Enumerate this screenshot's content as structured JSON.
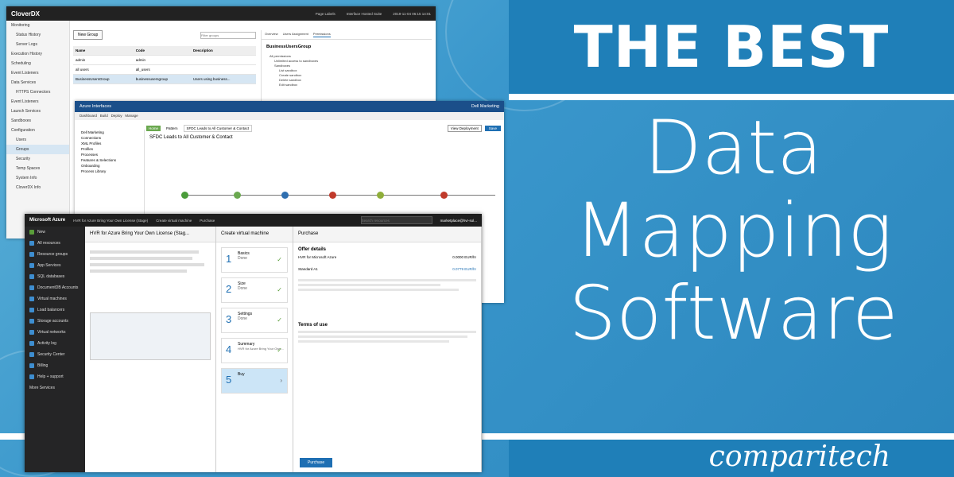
{
  "banner": {
    "title_top": "THE BEST",
    "title_line1": "Data",
    "title_line2": "Mapping",
    "title_line3": "Software",
    "logo": "comparitech"
  },
  "cloverdx": {
    "app_title": "CloverDX",
    "header_items": [
      "Page Labels",
      "Interface Hosted Suite",
      "2019-11-04 06:15 14:01"
    ],
    "sidebar": [
      "Monitoring",
      "Status History",
      "Server Logs",
      "Execution History",
      "Scheduling",
      "Event Listeners",
      "Data Services",
      "HTTPS Connectors",
      "Event Listeners",
      "Launch Services",
      "Sandboxes",
      "Configuration",
      "Users",
      "Groups",
      "Security",
      "Temp Spaces",
      "System Info",
      "CloverDX Info"
    ],
    "new_group_button": "New Group",
    "search_placeholder": "Filter groups",
    "table_headers": [
      "Name",
      "Code",
      "Description"
    ],
    "rows": [
      [
        "admin",
        "admin",
        ""
      ],
      [
        "all users",
        "all_users",
        ""
      ],
      [
        "BusinessUsersGroup",
        "businessusersgroup",
        "Users using business..."
      ]
    ],
    "detail_tabs": [
      "Overview",
      "Users Assignment",
      "Permissions"
    ],
    "detail_title": "BusinessUsersGroup",
    "permissions": [
      "All permissions",
      "Unlimited access to sandboxes",
      "Sandboxes",
      "List sandbox",
      "Create sandbox",
      "Delete sandbox",
      "Edit sandbox"
    ]
  },
  "azure_logic": {
    "app_title": "Azure Interfaces",
    "menu": [
      "Dashboard",
      "Build",
      "Deploy",
      "Manage"
    ],
    "user": "Dell Marketing",
    "tabs": [
      "Home",
      "Pattern",
      "SFDC Leads to All Customer & Contact"
    ],
    "canvas_title": "SFDC Leads to All Customer & Contact",
    "tree": [
      "Dell Marketing",
      "Connections",
      "XML Profiles",
      "Profiles",
      "Processes",
      "Features & Selections",
      "Onboarding",
      "Process Library"
    ],
    "actions": [
      "View Deployment",
      "Save"
    ]
  },
  "azure_portal": {
    "brand": "Microsoft Azure",
    "breadcrumbs": [
      "HVR for Azure Bring Your Own License (Stage)",
      "Create virtual machine",
      "Purchase"
    ],
    "search_placeholder": "Search resources",
    "account": "marketplace@hvr-sol...",
    "nav": [
      "New",
      "All resources",
      "Resource groups",
      "App Services",
      "SQL databases",
      "DocumentDB Accounts",
      "Virtual machines",
      "Load balancers",
      "Storage accounts",
      "Virtual networks",
      "Activity log",
      "Security Center",
      "Billing",
      "Help + support",
      "More Services"
    ],
    "blade1_title": "HVR for Azure Bring Your Own License (Stag...",
    "blade2_title": "Create virtual machine",
    "steps": [
      {
        "num": "1",
        "label": "Basics",
        "status": "Done"
      },
      {
        "num": "2",
        "label": "Size",
        "status": "Done"
      },
      {
        "num": "3",
        "label": "Settings",
        "status": "Done"
      },
      {
        "num": "4",
        "label": "Summary",
        "status": "HVR for Azure Bring Your Own..."
      },
      {
        "num": "5",
        "label": "Buy",
        "status": ""
      }
    ],
    "blade3_title": "Purchase",
    "offer_heading": "Offer details",
    "offer_items": [
      "HVR for Microsoft Azure",
      "Standard A1"
    ],
    "offer_prices": [
      "0.0000 EUR/hr",
      "0.0779 EUR/hr"
    ],
    "terms_heading": "Terms of use",
    "purchase_button": "Purchase"
  }
}
